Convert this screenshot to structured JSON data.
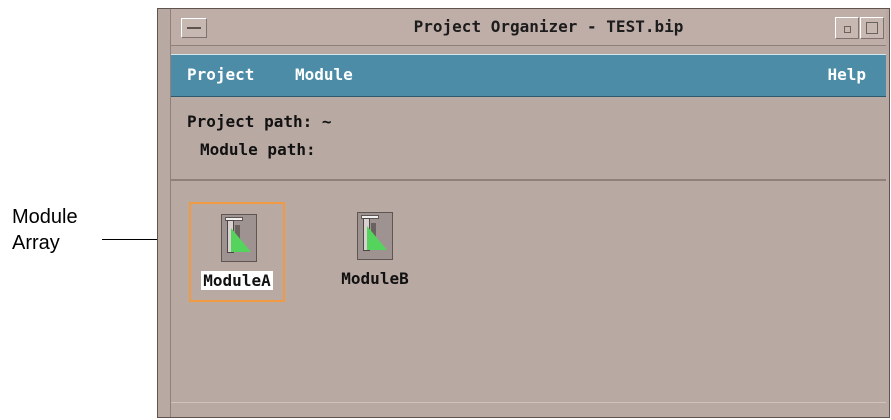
{
  "annotation": {
    "line1": "Module",
    "line2": "Array"
  },
  "window": {
    "title": "Project Organizer - TEST.bip"
  },
  "menu": {
    "project": "Project",
    "module": "Module",
    "help": "Help"
  },
  "paths": {
    "project_label": "Project path: ~",
    "module_label": "Module path:"
  },
  "modules": [
    {
      "label": "ModuleA"
    },
    {
      "label": "ModuleB"
    }
  ],
  "icons": {
    "system_menu": "system-menu-icon",
    "minimize": "minimize-icon",
    "maximize": "maximize-icon",
    "module": "module-icon"
  },
  "colors": {
    "menubar": "#4c8ca7",
    "selection_border": "#f19a42",
    "window_bg": "#b9a9a3"
  }
}
